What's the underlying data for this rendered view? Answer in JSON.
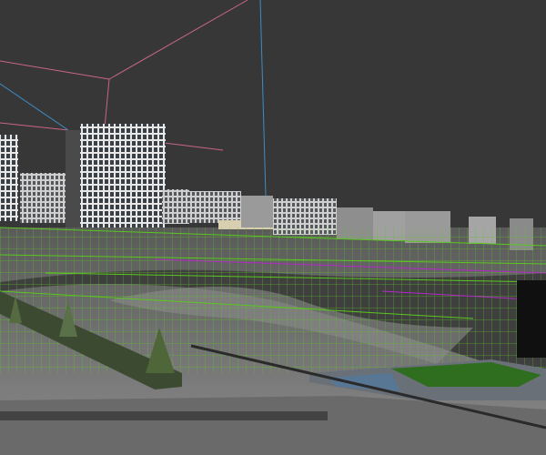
{
  "viewport": {
    "background_color": "#373737",
    "gizmo_colors": {
      "pink": "#c8648c",
      "blue": "#3c8cc8"
    },
    "helper_color": "#5ac81e",
    "selection_color": "#b428c8",
    "ground_color": "#6e6e6e",
    "grass_color": "#2e6e1e"
  }
}
